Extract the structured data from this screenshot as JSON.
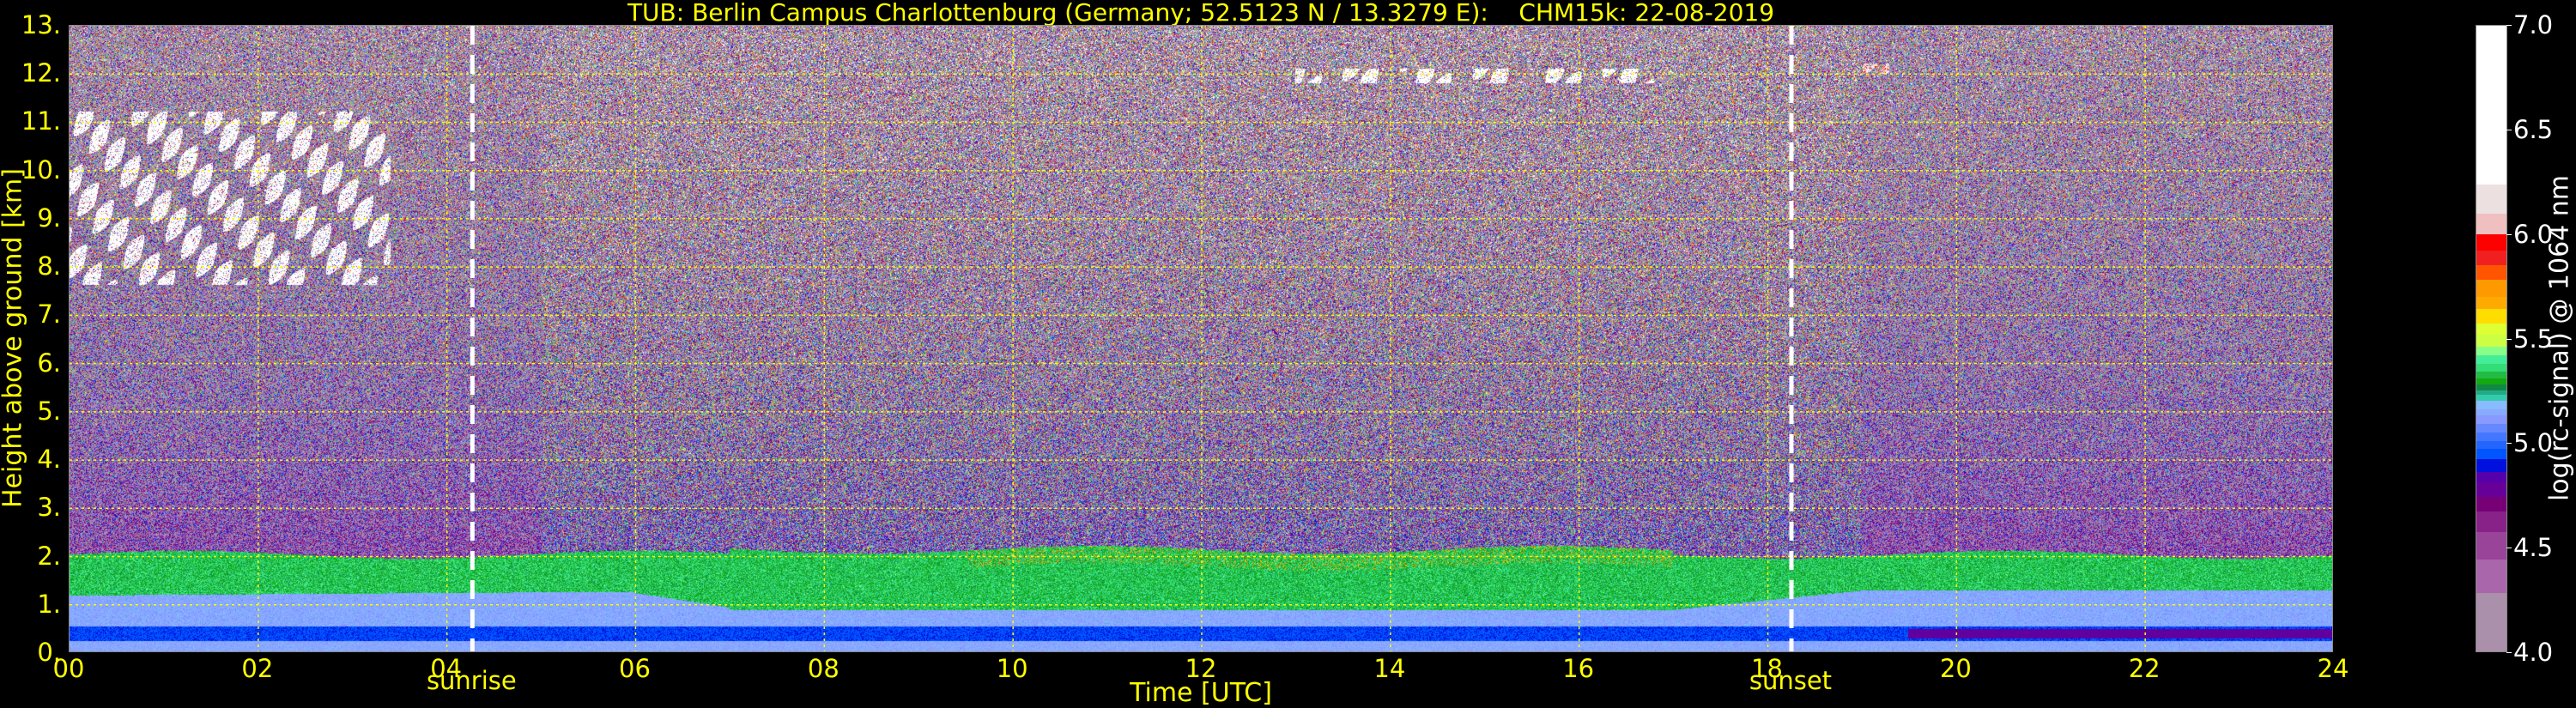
{
  "chart_data": {
    "type": "heatmap",
    "title": "TUB: Berlin Campus Charlottenburg (Germany; 52.5123 N / 13.3279 E):    CHM15k: 22-08-2019",
    "xlabel": "Time [UTC]",
    "ylabel": "Height above ground [km]",
    "xlim": [
      0,
      24
    ],
    "ylim": [
      0,
      13
    ],
    "x_ticks": [
      "00",
      "02",
      "04",
      "06",
      "08",
      "10",
      "12",
      "14",
      "16",
      "18",
      "20",
      "22",
      "24"
    ],
    "x_tick_values": [
      0,
      2,
      4,
      6,
      8,
      10,
      12,
      14,
      16,
      18,
      20,
      22,
      24
    ],
    "y_ticks": [
      "0.",
      "1.",
      "2.",
      "3.",
      "4.",
      "5.",
      "6.",
      "7.",
      "8.",
      "9.",
      "10.",
      "11.",
      "12.",
      "13."
    ],
    "y_tick_values": [
      0,
      1,
      2,
      3,
      4,
      5,
      6,
      7,
      8,
      9,
      10,
      11,
      12,
      13
    ],
    "grid": true,
    "grid_color": "#ffff00",
    "events": [
      {
        "label": "sunrise",
        "time": 4.27
      },
      {
        "label": "sunset",
        "time": 18.25
      }
    ],
    "features": {
      "boundary_layer_top_km": 2.0,
      "cirrus": [
        {
          "t": [
            0,
            3.4
          ],
          "h": [
            7.6,
            11.2
          ],
          "value": 6.5
        },
        {
          "t": [
            13.0,
            16.8
          ],
          "h": [
            11.8,
            12.1
          ],
          "value": 6.6
        },
        {
          "t": [
            19.0,
            19.3
          ],
          "h": [
            12.0,
            12.2
          ],
          "value": 6.2
        }
      ]
    },
    "colorbar": {
      "label": "log(rc-signal) @ 1064 nm",
      "range": [
        4.0,
        7.0
      ],
      "ticks": [
        "4.0",
        "4.5",
        "5.0",
        "5.5",
        "6.0",
        "6.5",
        "7.0"
      ],
      "tick_values": [
        4.0,
        4.5,
        5.0,
        5.5,
        6.0,
        6.5,
        7.0
      ],
      "levels": [
        4.0,
        4.28,
        4.44,
        4.57,
        4.67,
        4.74,
        4.81,
        4.86,
        4.92,
        4.97,
        5.01,
        5.05,
        5.09,
        5.13,
        5.16,
        5.2,
        5.23,
        5.25,
        5.28,
        5.31,
        5.34,
        5.38,
        5.42,
        5.46,
        5.52,
        5.57,
        5.64,
        5.7,
        5.78,
        5.85,
        5.92,
        6.0,
        6.1,
        6.24,
        7.0
      ],
      "colors": [
        "#aa90aa",
        "#aa66aa",
        "#994499",
        "#882288",
        "#770077",
        "#660099",
        "#5500aa",
        "#0011dd",
        "#0055ff",
        "#2266ff",
        "#4477ff",
        "#6688ff",
        "#8899ff",
        "#88aaff",
        "#88bbff",
        "#33ccaa",
        "#22aa88",
        "#118844",
        "#11aa11",
        "#22bb44",
        "#33dd77",
        "#44ee99",
        "#88ff88",
        "#ccff44",
        "#ddff33",
        "#ffdd00",
        "#ffaa00",
        "#ff9900",
        "#ff5500",
        "#f02020",
        "#ff0000",
        "#f0c0c0",
        "#ece0e0",
        "#ffffff"
      ]
    }
  }
}
